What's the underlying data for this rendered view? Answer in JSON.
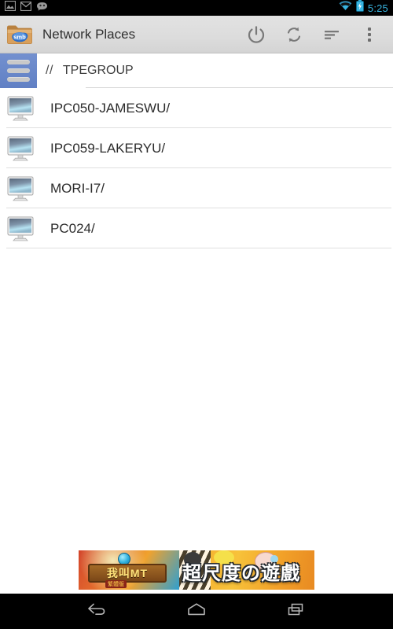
{
  "status_bar": {
    "icons_left": [
      "photo-icon",
      "gmail-icon",
      "hangouts-icon"
    ],
    "wifi_icon": "wifi-icon",
    "battery_icon": "battery-charging-icon",
    "clock": "5:25",
    "accent_color": "#38b4e0"
  },
  "action_bar": {
    "app_icon": "smb-folder-icon",
    "app_icon_label": "smb",
    "title": "Network Places",
    "actions": [
      {
        "name": "power-button",
        "icon": "power-icon"
      },
      {
        "name": "refresh-button",
        "icon": "refresh-icon"
      },
      {
        "name": "sort-button",
        "icon": "sort-icon"
      },
      {
        "name": "overflow-button",
        "icon": "overflow-menu-icon"
      }
    ],
    "background_color": "#dcdcdc"
  },
  "breadcrumb": {
    "menu_button_icon": "hamburger-menu-icon",
    "menu_button_color": "#6a87c9",
    "separator": "//",
    "path": "TPEGROUP"
  },
  "list": {
    "item_icon": "computer-monitor-icon",
    "items": [
      {
        "label": "IPC050-JAMESWU/"
      },
      {
        "label": "IPC059-LAKERYU/"
      },
      {
        "label": "MORI-I7/"
      },
      {
        "label": "PC024/"
      }
    ]
  },
  "ad_banner": {
    "left_logo_text": "我叫MT",
    "left_sub_text": "繁體版",
    "right_text": "超尺度の遊戲"
  },
  "nav_bar": {
    "buttons": [
      {
        "name": "back-button",
        "icon": "back-icon"
      },
      {
        "name": "home-button",
        "icon": "home-icon"
      },
      {
        "name": "recents-button",
        "icon": "recents-icon"
      }
    ]
  }
}
